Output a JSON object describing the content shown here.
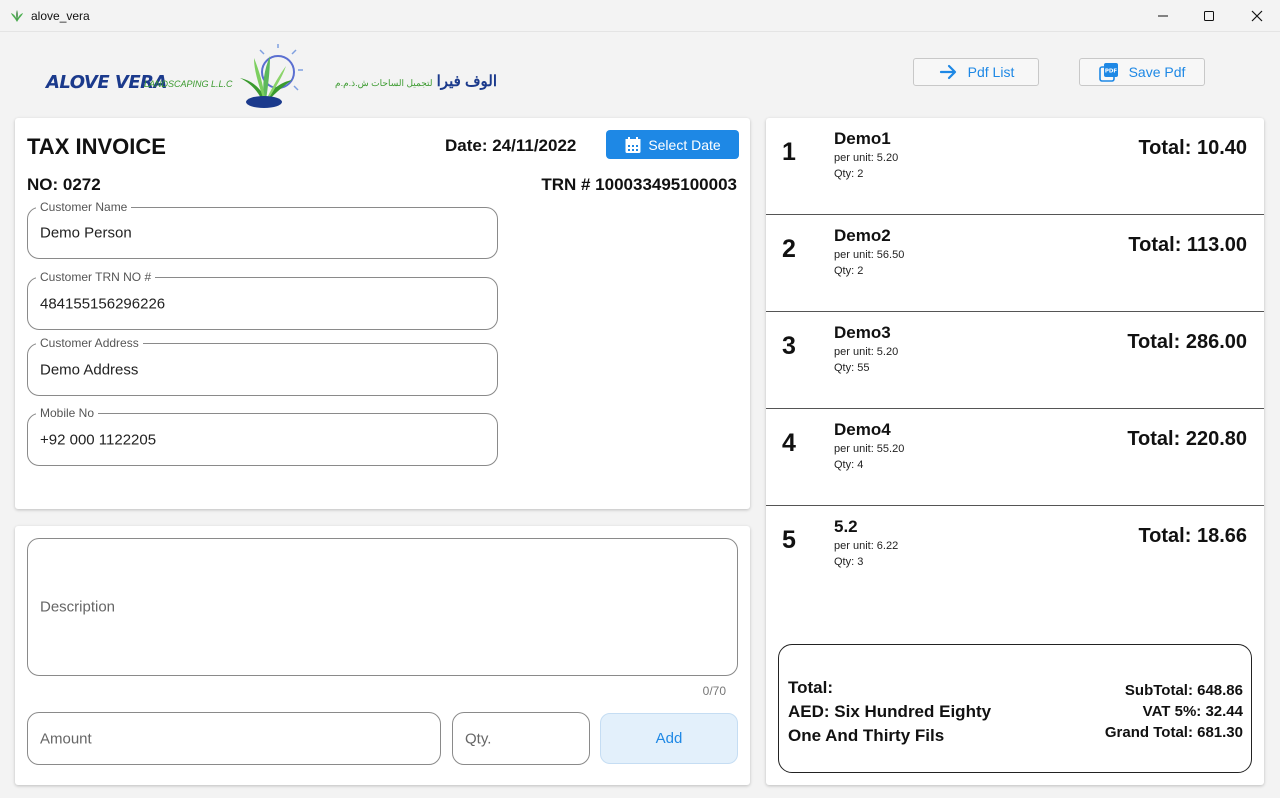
{
  "window": {
    "title": "alove_vera"
  },
  "header": {
    "logo": {
      "name_en": "ALOVE VERA",
      "sub_en": "LANDSCAPING L.L.C",
      "name_ar": "الوف فيرا",
      "sub_ar": "لتجميل الساحات ش.ذ.م.م"
    },
    "pdf_list_label": "Pdf List",
    "save_pdf_label": "Save Pdf"
  },
  "invoice": {
    "title": "TAX INVOICE",
    "date": "Date: 24/11/2022",
    "select_date_label": "Select Date",
    "number": "NO: 0272",
    "trn": "TRN # 100033495100003",
    "fields": {
      "customer_name": {
        "label": "Customer Name",
        "value": "Demo Person"
      },
      "customer_trn": {
        "label": "Customer TRN NO #",
        "value": "484155156296226"
      },
      "customer_address": {
        "label": "Customer Address",
        "value": "Demo Address"
      },
      "mobile": {
        "label": "Mobile No",
        "value": "+92 000 1122205"
      }
    }
  },
  "entry": {
    "description_placeholder": "Description",
    "counter": "0/70",
    "amount_placeholder": "Amount",
    "qty_placeholder": "Qty.",
    "add_label": "Add"
  },
  "items": [
    {
      "index": "1",
      "name": "Demo1",
      "per_unit": "per unit: 5.20",
      "qty": "Qty: 2",
      "total": "Total: 10.40"
    },
    {
      "index": "2",
      "name": "Demo2",
      "per_unit": "per unit: 56.50",
      "qty": "Qty: 2",
      "total": "Total: 113.00"
    },
    {
      "index": "3",
      "name": "Demo3",
      "per_unit": "per unit: 5.20",
      "qty": "Qty: 55",
      "total": "Total: 286.00"
    },
    {
      "index": "4",
      "name": "Demo4",
      "per_unit": "per unit: 55.20",
      "qty": "Qty: 4",
      "total": "Total: 220.80"
    },
    {
      "index": "5",
      "name": "5.2",
      "per_unit": "per unit: 6.22",
      "qty": "Qty: 3",
      "total": "Total: 18.66"
    }
  ],
  "summary": {
    "total_label": "Total:",
    "words_line1": "AED: Six Hundred Eighty",
    "words_line2": "One And Thirty Fils",
    "subtotal": "SubTotal: 648.86",
    "vat": "VAT 5%: 32.44",
    "grand_total": "Grand Total: 681.30"
  },
  "colors": {
    "accent": "#1e88e5",
    "logo_blue": "#1b3a8c",
    "logo_green": "#3a9a2e"
  }
}
